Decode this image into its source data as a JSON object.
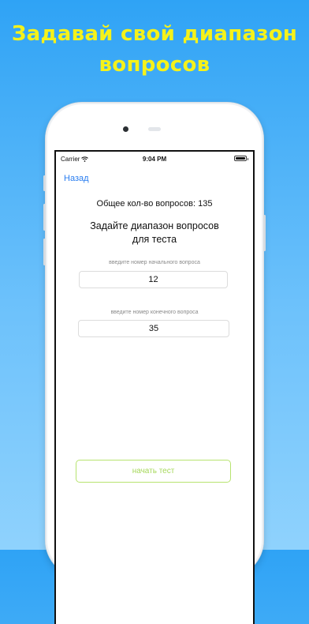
{
  "headline": {
    "line1": "Задавай свой диапазон",
    "line2": "вопросов"
  },
  "status_bar": {
    "carrier": "Carrier",
    "time": "9:04 PM"
  },
  "nav": {
    "back_label": "Назад"
  },
  "content": {
    "total_questions": "Общее кол-во вопросов: 135",
    "prompt_line1": "Задайте диапазон вопросов",
    "prompt_line2": "для теста",
    "start_field_label": "введите номер начального вопроса",
    "start_field_value": "12",
    "end_field_label": "введите номер конечного вопроса",
    "end_field_value": "35",
    "start_button_label": "начать тест"
  },
  "colors": {
    "headline": "#f5f21a",
    "background_top": "#2fa3f5",
    "link": "#2a7ef0",
    "button_accent": "#a6d85a"
  },
  "icons": [
    "wifi-icon",
    "battery-icon"
  ]
}
